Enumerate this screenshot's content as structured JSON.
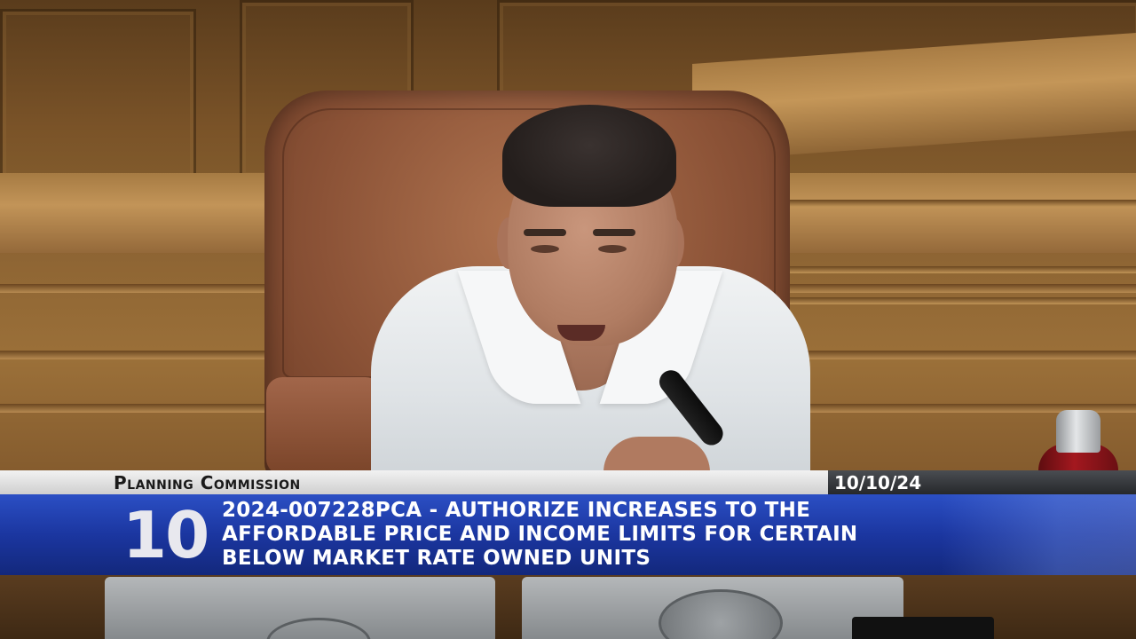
{
  "lower_third": {
    "organization": "Planning Commission",
    "date": "10/10/24",
    "item_number": "10",
    "item_lines": [
      "2024-007228PCA - AUTHORIZE INCREASES TO THE",
      "AFFORDABLE PRICE AND INCOME LIMITS FOR CERTAIN",
      "BELOW MARKET RATE OWNED UNITS"
    ]
  },
  "colors": {
    "banner_blue": "#1b36a0",
    "banner_top_light": "#e0e0e0",
    "banner_top_dark": "#2e3034",
    "wood": "#8d6433",
    "chair_leather": "#8c5337",
    "shirt": "#e4e7ea",
    "bottle_red": "#a3181f"
  }
}
